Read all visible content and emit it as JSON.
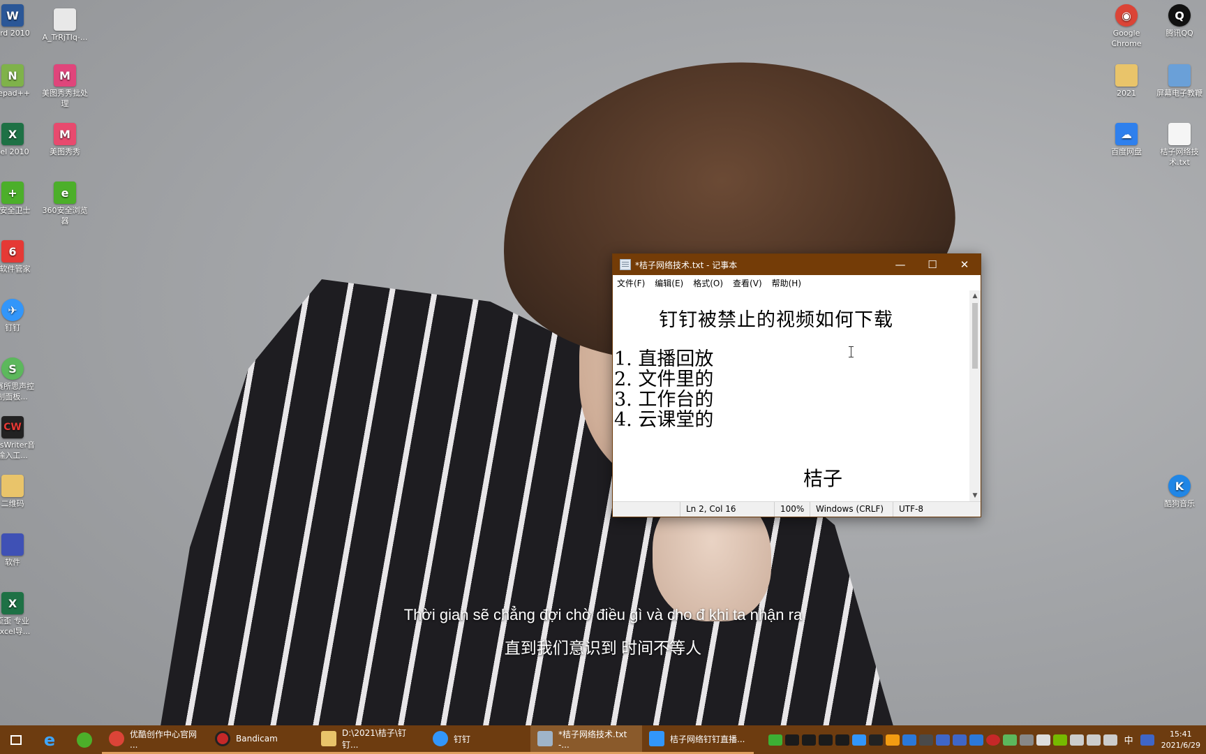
{
  "desktop_left": [
    {
      "label": "ord 2010",
      "glyph": "W",
      "color": "#2b5797"
    },
    {
      "label": "A_TrRjTIq-...",
      "glyph": "",
      "color": "#e8e8e8"
    },
    {
      "label": "tepad++",
      "glyph": "N",
      "color": "#7fb24a"
    },
    {
      "label": "美图秀秀批处理",
      "glyph": "M",
      "color": "#e0457b"
    },
    {
      "label": "cel 2010",
      "glyph": "X",
      "color": "#1e7145"
    },
    {
      "label": "美图秀秀",
      "glyph": "M",
      "color": "#e84a6e"
    },
    {
      "label": "0安全卫士",
      "glyph": "+",
      "color": "#4caf2a"
    },
    {
      "label": "360安全浏览器",
      "glyph": "e",
      "color": "#4caf2a"
    },
    {
      "label": "0软件管家",
      "glyph": "6",
      "color": "#e53935"
    },
    {
      "label": "钉钉",
      "glyph": "✈",
      "color": "#3296fa"
    },
    {
      "label": "S赛所思声控制面板...",
      "glyph": "S",
      "color": "#5cb85c"
    },
    {
      "label": "apsWriter音输入工...",
      "glyph": "CW",
      "color": "#222222"
    },
    {
      "label": "二维码",
      "glyph": "",
      "color": "#e9c46a"
    },
    {
      "label": "软件",
      "glyph": "",
      "color": "#3f51b5"
    },
    {
      "label": "歪歪 专业Excel导...",
      "glyph": "X",
      "color": "#1e7145"
    }
  ],
  "desktop_right": [
    {
      "label": "Google Chrome",
      "glyph": "◉",
      "color": "#db4437"
    },
    {
      "label": "腾讯QQ",
      "glyph": "Q",
      "color": "#111111"
    },
    {
      "label": "2021",
      "glyph": "",
      "color": "#e9c46a"
    },
    {
      "label": "屏幕电子教鞭",
      "glyph": "",
      "color": "#6aa0d8"
    },
    {
      "label": "百度网盘",
      "glyph": "☁",
      "color": "#2f80ed"
    },
    {
      "label": "桔子网络技术.txt",
      "glyph": "",
      "color": "#f5f5f5"
    },
    {
      "label": "酷狗音乐",
      "glyph": "K",
      "color": "#2086e6"
    }
  ],
  "window": {
    "title": "*桔子网络技术.txt - 记事本",
    "minimize": "—",
    "maximize": "☐",
    "close": "✕",
    "menu": [
      "文件(F)",
      "编辑(E)",
      "格式(O)",
      "查看(V)",
      "帮助(H)"
    ],
    "content": {
      "heading": "钉钉被禁止的视频如何下载",
      "items": [
        "1. 直播回放",
        "2. 文件里的",
        "3. 工作台的",
        "4. 云课堂的"
      ],
      "signature": "桔子"
    },
    "status": {
      "position": "Ln 2,  Col 16",
      "zoom": "100%",
      "line_ending": "Windows (CRLF)",
      "encoding": "UTF-8"
    }
  },
  "subtitles": {
    "line1": "Thời gian sẽ chẳng đợi chờ điều gì và cho đ khi ta nhận ra",
    "line2": "直到我们意识到 时间不等人"
  },
  "taskbar": {
    "apps": [
      {
        "label": "优酷创作中心官网 ...",
        "color": "#db4437"
      },
      {
        "label": "Bandicam",
        "color": "#c62828"
      },
      {
        "label": "D:\\2021\\桔子\\钉钉...",
        "color": "#e9c46a"
      },
      {
        "label": "钉钉",
        "color": "#3296fa"
      },
      {
        "label": "*桔子网络技术.txt -...",
        "color": "#9fb4c8"
      },
      {
        "label": "桔子网络钉钉直播...",
        "color": "#3296fa"
      }
    ],
    "ime": "中",
    "time": "15:41",
    "date": "2021/6/29"
  }
}
